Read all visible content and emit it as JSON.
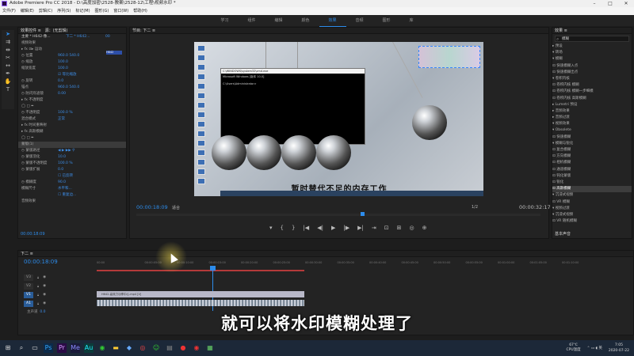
{
  "window": {
    "title": "Adobe Premiere Pro CC 2018 - D:\\高度加密\\2528-教案\\2528-12\\工程\\视频水印 *"
  },
  "menu": [
    "文件(F)",
    "编辑(E)",
    "剪辑(C)",
    "序列(S)",
    "标记(M)",
    "图形(G)",
    "窗口(W)",
    "帮助(H)"
  ],
  "workspaces": [
    {
      "label": "学习",
      "active": false
    },
    {
      "label": "组件",
      "active": false
    },
    {
      "label": "编辑",
      "active": false
    },
    {
      "label": "颜色",
      "active": false
    },
    {
      "label": "效果",
      "active": true
    },
    {
      "label": "音频",
      "active": false
    },
    {
      "label": "图形",
      "active": false
    },
    {
      "label": "库",
      "active": false
    }
  ],
  "effect_controls": {
    "tab": "效果控件 ≡",
    "tab2": "源：(无剪辑)",
    "source": "主要 * H642-像...",
    "seq": "下二 * H642...",
    "time": "00",
    "mini_clip": "H642",
    "timecode": "00:00:18:09",
    "rows": [
      {
        "t": "视频效果",
        "v": "",
        "sel": false
      },
      {
        "t": "▸ fx ⊡▸ 运动",
        "v": "",
        "sel": false
      },
      {
        "t": "   ◷ 位置",
        "v": "960.0    540.0",
        "sel": false
      },
      {
        "t": "   ◷ 缩放",
        "v": "100.0",
        "sel": false
      },
      {
        "t": "     缩放宽度",
        "v": "100.0",
        "sel": false
      },
      {
        "t": "",
        "v": "☑ 等比缩放",
        "sel": false
      },
      {
        "t": "   ◷ 旋转",
        "v": "0.0",
        "sel": false
      },
      {
        "t": "     锚点",
        "v": "960.0    540.0",
        "sel": false
      },
      {
        "t": "   ◷ 防闪烁滤镜",
        "v": "0.00",
        "sel": false
      },
      {
        "t": "▸ fx 不透明度",
        "v": "",
        "sel": false
      },
      {
        "t": "   ◯ □ ✒",
        "v": "",
        "sel": false
      },
      {
        "t": "   ◷ 不透明度",
        "v": "100.0 %",
        "sel": false
      },
      {
        "t": "     混合模式",
        "v": "正常",
        "sel": false
      },
      {
        "t": "▸ fx 时间重映射",
        "v": "",
        "sel": false
      },
      {
        "t": "▸ fx 高斯模糊",
        "v": "",
        "sel": false
      },
      {
        "t": "   ◯ □ ✒",
        "v": "",
        "sel": false
      },
      {
        "t": "     蒙版(1)",
        "v": "",
        "sel": true
      },
      {
        "t": "     ◷ 蒙版路径",
        "v": "◀ ▶ ▶▶ ⚲",
        "sel": false
      },
      {
        "t": "     ◷ 蒙版羽化",
        "v": "10.0",
        "sel": false
      },
      {
        "t": "     ◷ 蒙版不透明度",
        "v": "100.0 %",
        "sel": false
      },
      {
        "t": "     ◷ 蒙版扩展",
        "v": "0.0",
        "sel": false
      },
      {
        "t": "",
        "v": "☐ 已反转",
        "sel": false
      },
      {
        "t": "   ◷ 模糊度",
        "v": "90.0",
        "sel": false
      },
      {
        "t": "     模糊尺寸",
        "v": "水平和...",
        "sel": false
      },
      {
        "t": "",
        "v": "☐ 重复边...",
        "sel": false
      },
      {
        "t": "音频效果",
        "v": "",
        "sel": false
      }
    ]
  },
  "program": {
    "tab": "节目: 下二 ≡",
    "timecode": "00:00:18:09",
    "fit": "适合",
    "fraction": "1/2",
    "duration": "00:00:32:17",
    "video_subtitle": "暂时替代不足的内存工作",
    "cmd_title": "C:\\WINDOWS\\system32\\cmd.exe",
    "cmd_lines": [
      "C:\\Users\\Administrator>",
      "Microsoft Windows [版本 10.0]"
    ],
    "controls": [
      "▾",
      "{",
      "}",
      "|◀",
      "◀|",
      "▶",
      "|▶",
      "▶|",
      "⇥",
      "⊡",
      "⊞",
      "◎",
      "⊕"
    ]
  },
  "effects": {
    "tab": "效果 ≡",
    "search": "模糊",
    "rows": [
      {
        "t": "▸ 预设",
        "sel": false
      },
      {
        "t": "  ▾ 转场",
        "sel": false
      },
      {
        "t": "    ▾ 模糊",
        "sel": false
      },
      {
        "t": "        ⊡ 快速模糊入点",
        "sel": false
      },
      {
        "t": "        ⊡ 快速模糊出点",
        "sel": false
      },
      {
        "t": "  ▾ 卷积内核",
        "sel": false
      },
      {
        "t": "        ⊡ 卷积内核 模糊",
        "sel": false
      },
      {
        "t": "        ⊡ 卷积内核 模糊一步细模",
        "sel": false
      },
      {
        "t": "        ⊡ 卷积内核 高斯模糊",
        "sel": false
      },
      {
        "t": "▸ Lumetri 预设",
        "sel": false
      },
      {
        "t": "▸ 音频效果",
        "sel": false
      },
      {
        "t": "▸ 音频过渡",
        "sel": false
      },
      {
        "t": "▾ 视频效果",
        "sel": false
      },
      {
        "t": "  ▾ Obsolete",
        "sel": false
      },
      {
        "t": "      ⊡ 快速模糊",
        "sel": false
      },
      {
        "t": "  ▾ 模糊与锐化",
        "sel": false
      },
      {
        "t": "      ⊡ 复合模糊",
        "sel": false
      },
      {
        "t": "      ⊡ 方向模糊",
        "sel": false
      },
      {
        "t": "      ⊡ 相机模糊",
        "sel": false
      },
      {
        "t": "      ⊡ 通道模糊",
        "sel": false
      },
      {
        "t": "      ⊡ 钝化蒙版",
        "sel": false
      },
      {
        "t": "      ⊡ 锐化",
        "sel": false
      },
      {
        "t": "      ⊡ 高斯模糊",
        "sel": true
      },
      {
        "t": "  ▾ 沉浸式视频",
        "sel": false
      },
      {
        "t": "      ⊡ VR 模糊",
        "sel": false
      },
      {
        "t": "▾ 视频过渡",
        "sel": false
      },
      {
        "t": "  ▾ 沉浸式视频",
        "sel": false
      },
      {
        "t": "      ⊡ VR 随机模糊",
        "sel": false
      }
    ],
    "footer": "基本声音"
  },
  "timeline": {
    "tab": "下二 ≡",
    "timecode": "00:00:18:09",
    "ruler": [
      "00:00",
      "00:00:05:00",
      "00:00:10:00",
      "00:00:15:00",
      "00:00:20:00",
      "00:00:25:00",
      "00:00:30:00",
      "00:00:35:00",
      "00:00:40:00",
      "00:00:45:00",
      "00:00:50:00",
      "00:00:55:00",
      "00:01:00:00",
      "00:01:05:00",
      "00:01:10:00"
    ],
    "tracks": [
      {
        "name": "V3",
        "on": false
      },
      {
        "name": "V2",
        "on": false
      },
      {
        "name": "V1",
        "on": true
      },
      {
        "name": "A1",
        "on": true
      },
      {
        "name": "A2",
        "on": false
      }
    ],
    "master": "主声道",
    "master_val": "0.0",
    "video_clip": "H642-高效力功享中心.mp4 [V]"
  },
  "big_subtitle": "就可以将水印模糊处理了",
  "taskbar": {
    "temp": "67℃",
    "cpu": "CPU温度",
    "time": "7:05",
    "date": "2020-07-22"
  }
}
